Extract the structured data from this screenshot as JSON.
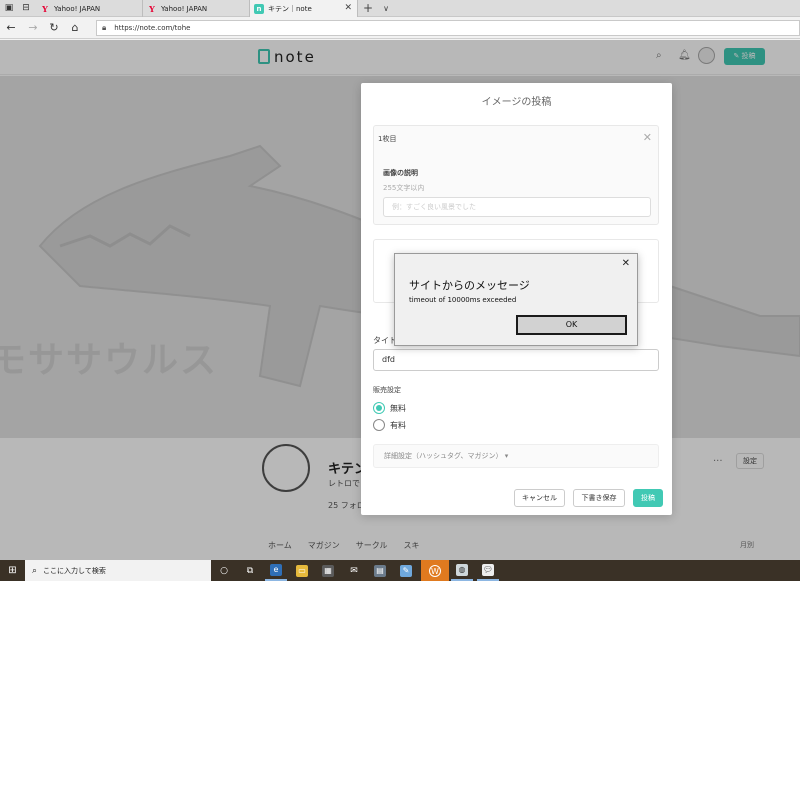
{
  "browser": {
    "tabs": [
      {
        "label": "Yahoo! JAPAN",
        "icon": "yahoo-icon"
      },
      {
        "label": "Yahoo! JAPAN",
        "icon": "yahoo-icon"
      },
      {
        "label": "キテン｜note",
        "icon": "note-icon",
        "active": true
      }
    ],
    "url": "https://note.com/tohe"
  },
  "site": {
    "logo": "note",
    "brand_color": "#41c9b4",
    "post_button": "投稿"
  },
  "profile": {
    "name": "キテン",
    "bio": "レトロでい",
    "follow": "25 フォロ",
    "settings": "設定",
    "more": "···",
    "tabs": [
      "ホーム",
      "マガジン",
      "サークル",
      "スキ"
    ],
    "month": "月別"
  },
  "cover": {
    "text": "モササウルス"
  },
  "modal": {
    "title": "イメージの投稿",
    "image_card": {
      "title": "1枚目",
      "desc_label": "画像の説明",
      "desc_hint": "255文字以内",
      "desc_placeholder": "例：すごく良い風景でした"
    },
    "title_label": "タイト",
    "title_value": "dfd",
    "sales_label": "販売設定",
    "options": [
      {
        "label": "無料",
        "selected": true
      },
      {
        "label": "有料",
        "selected": false
      }
    ],
    "detail_settings": "詳細設定（ハッシュタグ、マガジン）",
    "cancel": "キャンセル",
    "draft": "下書き保存",
    "submit": "投稿"
  },
  "dialog": {
    "title": "サイトからのメッセージ",
    "message": "timeout of 10000ms exceeded",
    "ok": "OK"
  },
  "taskbar": {
    "search_placeholder": "ここに入力して検索"
  }
}
